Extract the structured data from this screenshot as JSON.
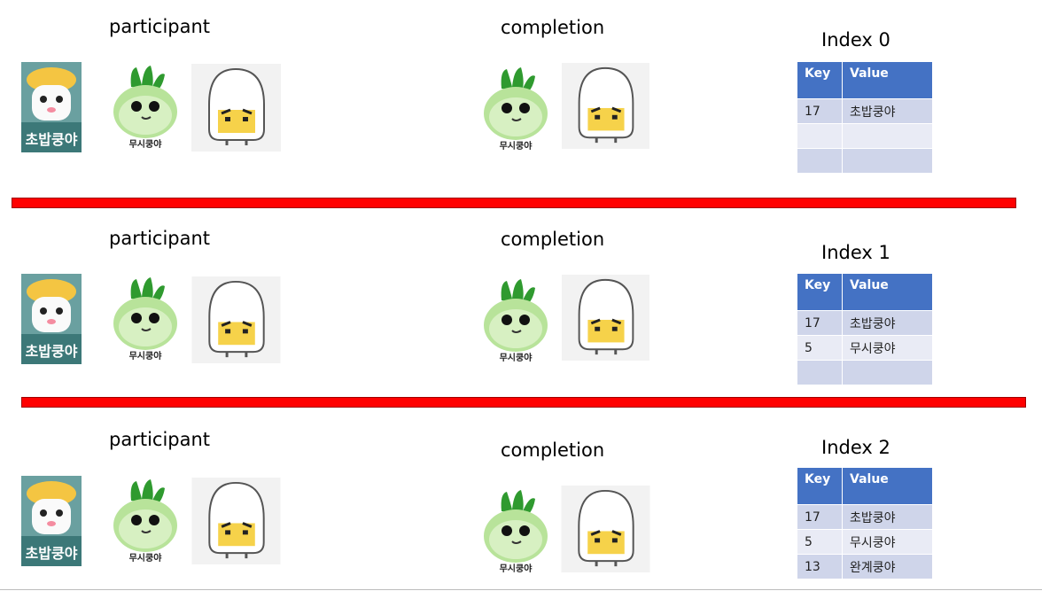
{
  "sections": [
    {
      "participant_label": "participant",
      "completion_label": "completion",
      "index_label": "Index 0",
      "table": {
        "key_header": "Key",
        "value_header": "Value",
        "rows": [
          {
            "key": "17",
            "value": "초밥쿵야"
          },
          {
            "key": "",
            "value": ""
          },
          {
            "key": "",
            "value": ""
          }
        ]
      }
    },
    {
      "participant_label": "participant",
      "completion_label": "completion",
      "index_label": "Index 1",
      "table": {
        "key_header": "Key",
        "value_header": "Value",
        "rows": [
          {
            "key": "17",
            "value": "초밥쿵야"
          },
          {
            "key": "5",
            "value": "무시쿵야"
          },
          {
            "key": "",
            "value": ""
          }
        ]
      }
    },
    {
      "participant_label": "participant",
      "completion_label": "completion",
      "index_label": "Index 2",
      "table": {
        "key_header": "Key",
        "value_header": "Value",
        "rows": [
          {
            "key": "17",
            "value": "초밥쿵야"
          },
          {
            "key": "5",
            "value": "무시쿵야"
          },
          {
            "key": "13",
            "value": "완계쿵야"
          }
        ]
      }
    }
  ],
  "characters": {
    "sushi_name": "초밥쿵야",
    "radish_name": "무시쿵야"
  },
  "colors": {
    "divider": "#ff0000",
    "table_header": "#4472c4",
    "table_row_dark": "#cfd5ea",
    "table_row_light": "#e9ebf5",
    "sushi_bg": "#6aa0a0"
  }
}
